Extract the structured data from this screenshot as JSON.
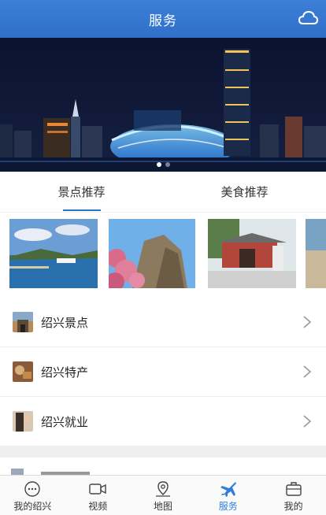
{
  "header": {
    "title": "服务",
    "right_icon": "cloud-icon"
  },
  "banner": {
    "slides": 2,
    "active_slide": 0
  },
  "tabs": [
    {
      "label": "景点推荐",
      "active": true
    },
    {
      "label": "美食推荐",
      "active": false
    }
  ],
  "list": [
    {
      "label": "绍兴景点",
      "icon": "landmark-thumbnail"
    },
    {
      "label": "绍兴特产",
      "icon": "food-thumbnail"
    },
    {
      "label": "绍兴就业",
      "icon": "job-thumbnail"
    }
  ],
  "bottom_nav": [
    {
      "label": "我的绍兴",
      "icon": "chat-bubble-icon",
      "active": false
    },
    {
      "label": "视频",
      "icon": "video-camera-icon",
      "active": false
    },
    {
      "label": "地图",
      "icon": "map-pin-icon",
      "active": false
    },
    {
      "label": "服务",
      "icon": "airplane-icon",
      "active": true
    },
    {
      "label": "我的",
      "icon": "briefcase-icon",
      "active": false
    }
  ],
  "colors": {
    "header": "#2f6fca",
    "active": "#2f7fd8"
  }
}
